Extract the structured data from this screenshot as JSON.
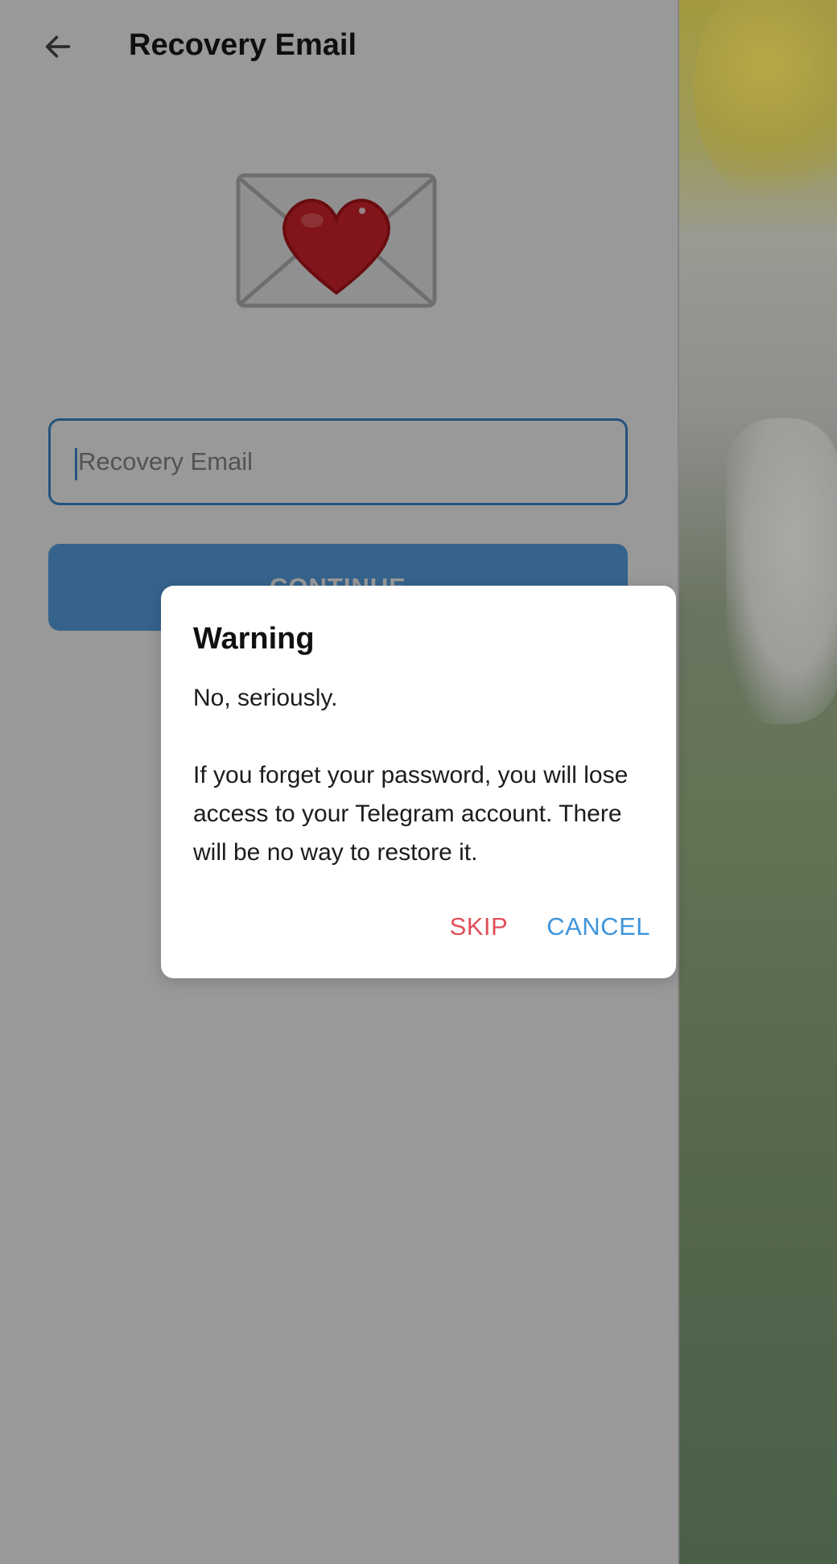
{
  "header": {
    "title": "Recovery Email",
    "back_icon": "arrow-left-icon"
  },
  "illustration": {
    "icon": "envelope-heart-icon"
  },
  "form": {
    "email_placeholder": "Recovery Email",
    "email_value": "",
    "continue_label": "CONTINUE"
  },
  "dialog": {
    "title": "Warning",
    "line1": "No, seriously.",
    "line2": "If you forget your password, you will lose access to your Telegram account. There will be no way to restore it.",
    "skip_label": "SKIP",
    "cancel_label": "CANCEL"
  },
  "colors": {
    "accent": "#3e8bd3",
    "button": "#5ba6ea",
    "skip": "#e0505a",
    "cancel": "#3f95db"
  }
}
